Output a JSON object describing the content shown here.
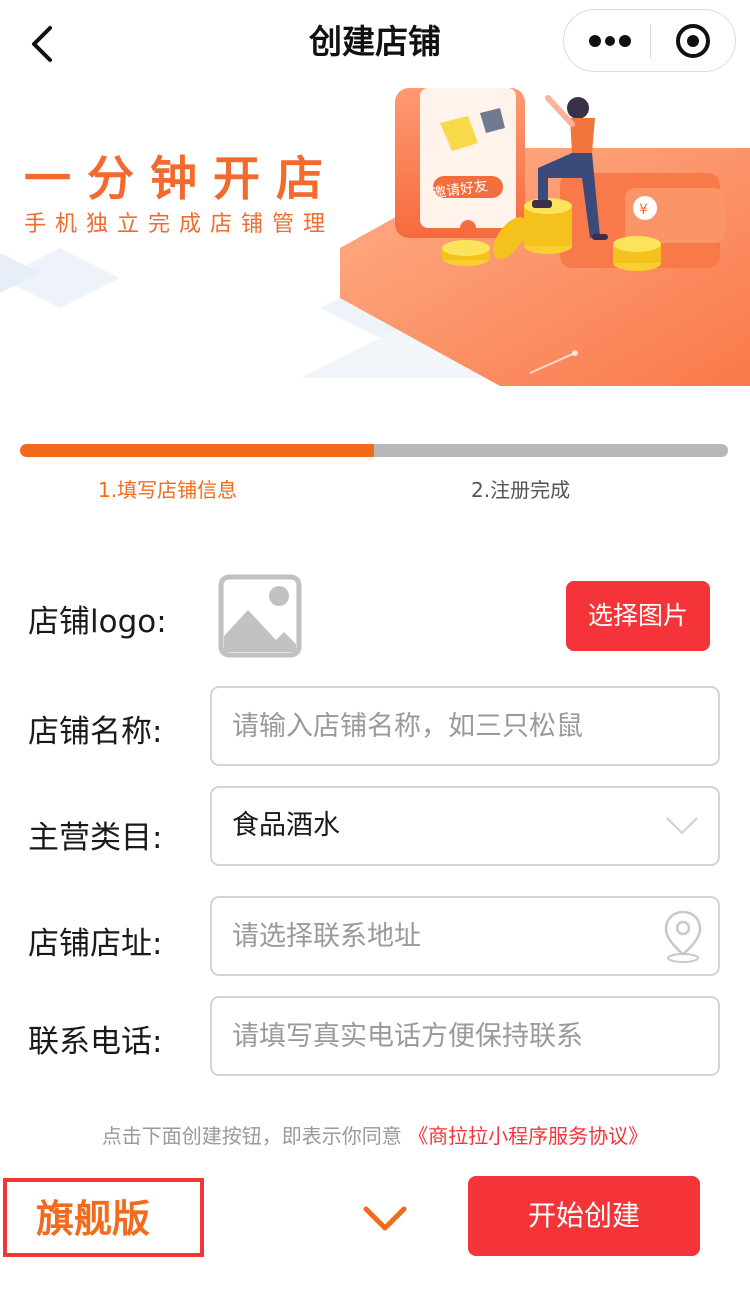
{
  "navbar": {
    "title": "创建店铺",
    "back_icon": "chevron-left-icon",
    "more_icon": "more-dots-icon",
    "close_icon": "target-circle-icon"
  },
  "banner": {
    "title": "一分钟开店",
    "subtitle": "手机独立完成店铺管理",
    "invite_text": "邀请好友",
    "accent_color": "#f26a2e"
  },
  "progress": {
    "value_percent": 50,
    "steps": [
      {
        "label": "1.填写店铺信息",
        "active": true
      },
      {
        "label": "2.注册完成",
        "active": false
      }
    ],
    "active_color": "#f26b1d",
    "inactive_color": "#b8b8b8"
  },
  "form": {
    "logo": {
      "label": "店铺logo:",
      "placeholder_icon": "image-placeholder-icon",
      "button_label": "选择图片"
    },
    "name": {
      "label": "店铺名称:",
      "value": "",
      "placeholder": "请输入店铺名称，如三只松鼠"
    },
    "category": {
      "label": "主营类目:",
      "value": "食品酒水",
      "icon": "chevron-down-icon"
    },
    "address": {
      "label": "店铺店址:",
      "value": "",
      "placeholder": "请选择联系地址",
      "icon": "location-pin-icon"
    },
    "phone": {
      "label": "联系电话:",
      "value": "",
      "placeholder": "请填写真实电话方便保持联系"
    }
  },
  "agreement": {
    "text": "点击下面创建按钮，即表示你同意",
    "link": "《商拉拉小程序服务协议》"
  },
  "bottom": {
    "version_label": "旗舰版",
    "expand_icon": "chevron-down-icon",
    "create_label": "开始创建",
    "button_color": "#f5343a"
  }
}
